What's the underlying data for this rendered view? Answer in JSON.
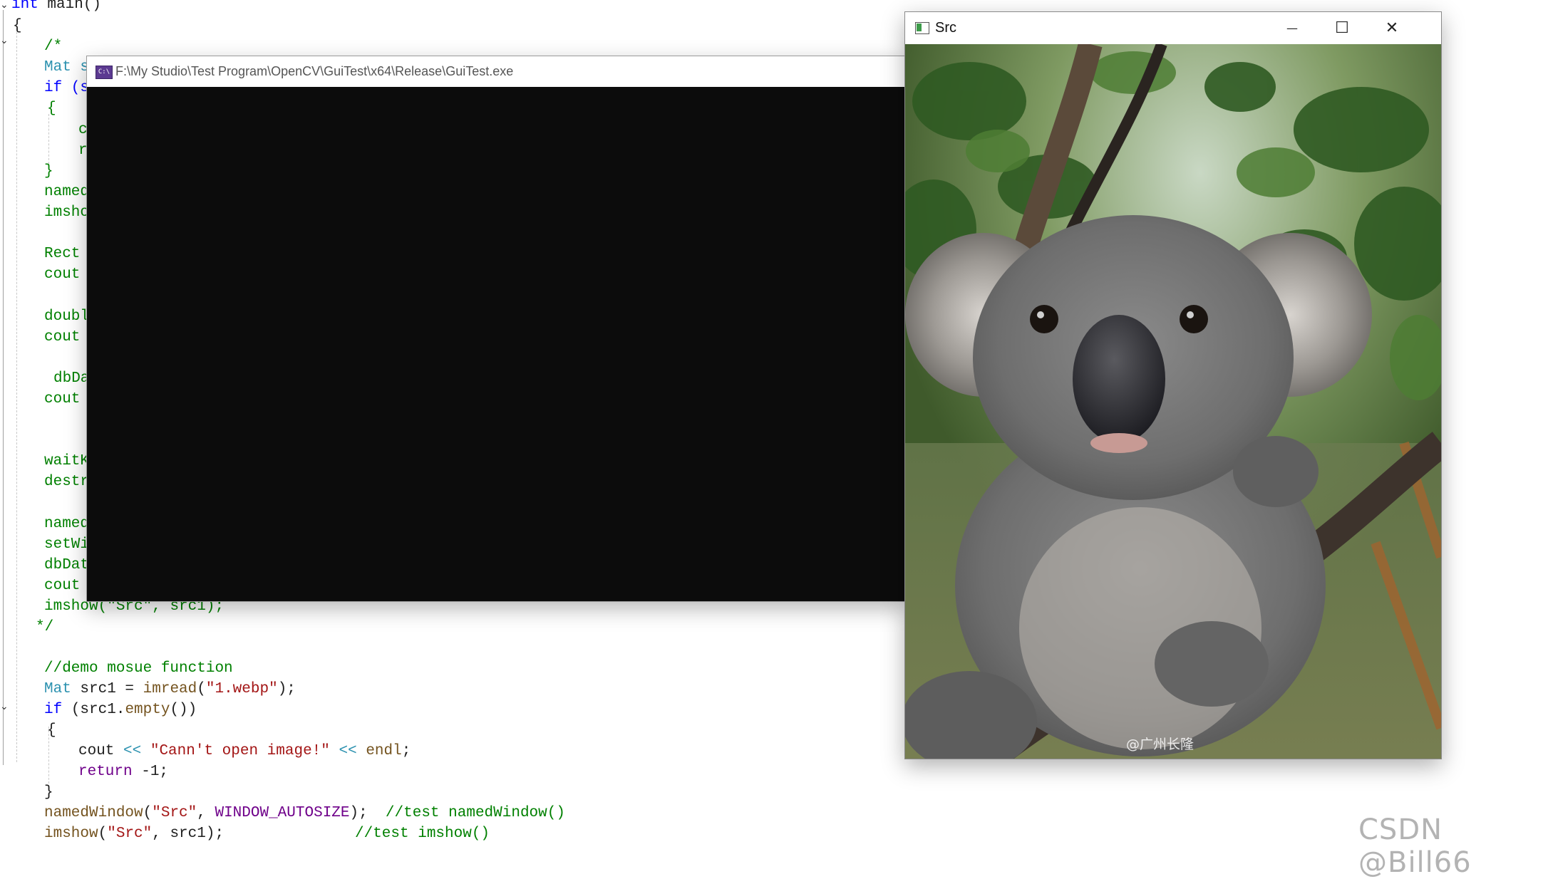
{
  "editor": {
    "lines": {
      "l1_kw": "int",
      "l1_rest": " main()",
      "l2": "{",
      "l3": "/*",
      "l4": "Mat s",
      "l5": "if (s",
      "l6": "{",
      "l7": "c",
      "l8": "r",
      "l9": "}",
      "l10": "named",
      "l11": "imsho",
      "l12": "Rect",
      "l13": "cout",
      "l14": "doubl",
      "l15": "cout",
      "l16": "dbDa",
      "l17": "cout",
      "l18": "waitK",
      "l19": "destr",
      "l20": "named",
      "l21": "setWi",
      "l22": "dbDat",
      "l23": "cout",
      "l24_a": "imshow(",
      "l24_b": "\"Src\"",
      "l24_c": ", src1);",
      "l25": "*/",
      "l26": "//demo mosue function",
      "l27_a": "Mat",
      "l27_b": " src1 = ",
      "l27_c": "imread",
      "l27_d": "(",
      "l27_e": "\"1.webp\"",
      "l27_f": ");",
      "l28_a": "if",
      "l28_b": " (src1.",
      "l28_c": "empty",
      "l28_d": "())",
      "l29": "{",
      "l30_a": "cout",
      "l30_b": " << ",
      "l30_c": "\"Cann't open image!\"",
      "l30_d": " << ",
      "l30_e": "endl",
      "l30_f": ";",
      "l31_a": "return",
      "l31_b": " -1;",
      "l32": "}",
      "l33_a": "namedWindow",
      "l33_b": "(",
      "l33_c": "\"Src\"",
      "l33_d": ", ",
      "l33_e": "WINDOW_AUTOSIZE",
      "l33_f": ");  ",
      "l33_g": "//test namedWindow()",
      "l34_a": "imshow",
      "l34_b": "(",
      "l34_c": "\"Src\"",
      "l34_d": ", src1);",
      "l34_e": "//test imshow()"
    }
  },
  "console": {
    "title": "F:\\My Studio\\Test Program\\OpenCV\\GuiTest\\x64\\Release\\GuiTest.exe",
    "icon": "console-icon"
  },
  "src_window": {
    "title": "Src",
    "minimize": "—",
    "maximize": "☐",
    "close": "✕",
    "watermark": "@广州长隆"
  },
  "page_watermark": "CSDN @Bill66",
  "colors": {
    "keyword": "#0000ff",
    "type": "#2b91af",
    "comment": "#008000",
    "string": "#a31515",
    "console_bg": "#0c0c0c"
  }
}
